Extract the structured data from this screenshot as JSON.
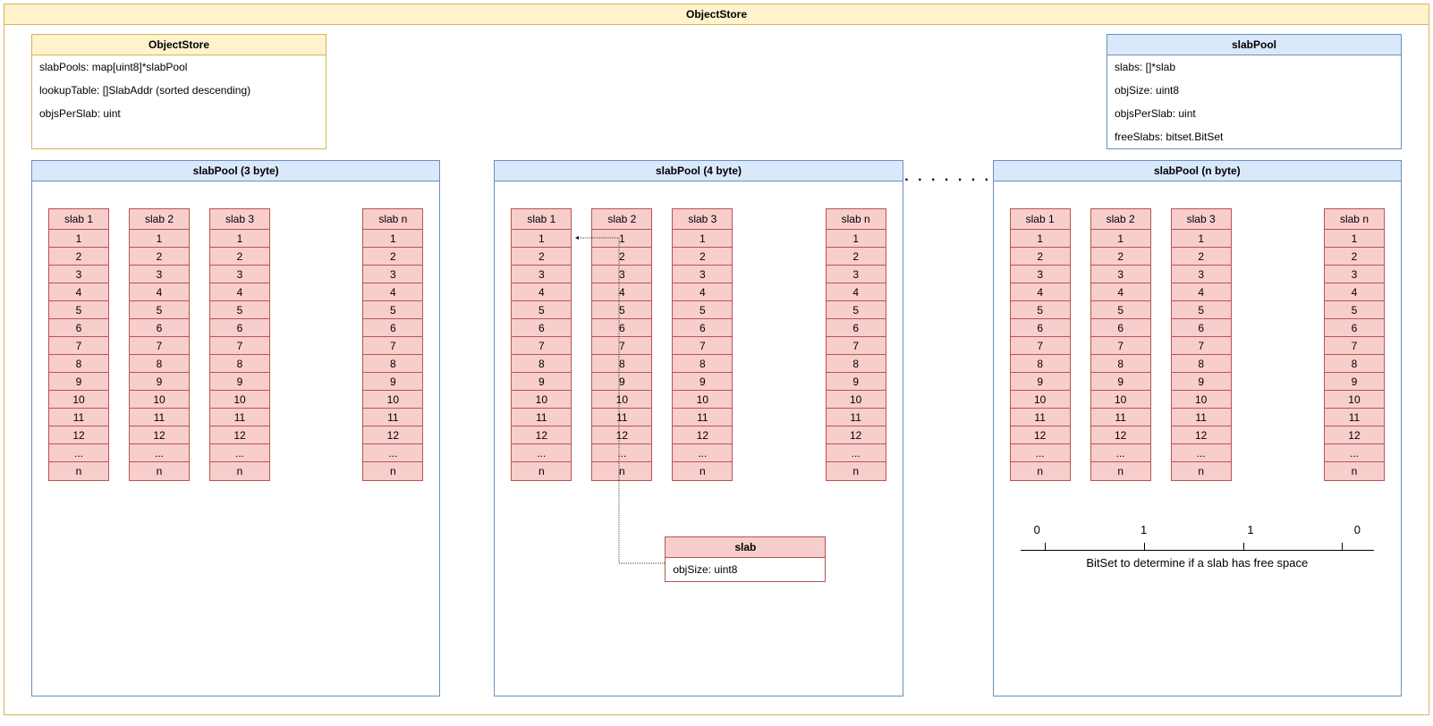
{
  "outer_title": "ObjectStore",
  "objectStore": {
    "title": "ObjectStore",
    "rows": [
      "slabPools: map[uint8]*slabPool",
      "lookupTable: []SlabAddr (sorted descending)",
      "objsPerSlab: uint"
    ]
  },
  "slabPoolClass": {
    "title": "slabPool",
    "rows": [
      "slabs: []*slab",
      "objSize: uint8",
      "objsPerSlab: uint",
      "freeSlabs: bitset.BitSet"
    ]
  },
  "slabClass": {
    "title": "slab",
    "rows": [
      "objSize: uint8"
    ]
  },
  "dots": ". . . . . . .",
  "pools": [
    {
      "title": "slabPool (3 byte)"
    },
    {
      "title": "slabPool (4 byte)"
    },
    {
      "title": "slabPool (n byte)"
    }
  ],
  "slabTitles": [
    "slab 1",
    "slab 2",
    "slab 3",
    "slab n"
  ],
  "slabRows": [
    "1",
    "2",
    "3",
    "4",
    "5",
    "6",
    "7",
    "8",
    "9",
    "10",
    "11",
    "12",
    "...",
    "n"
  ],
  "bitset": {
    "values": [
      "0",
      "1",
      "1",
      "0"
    ],
    "label": "BitSet to determine if a slab has free space"
  }
}
